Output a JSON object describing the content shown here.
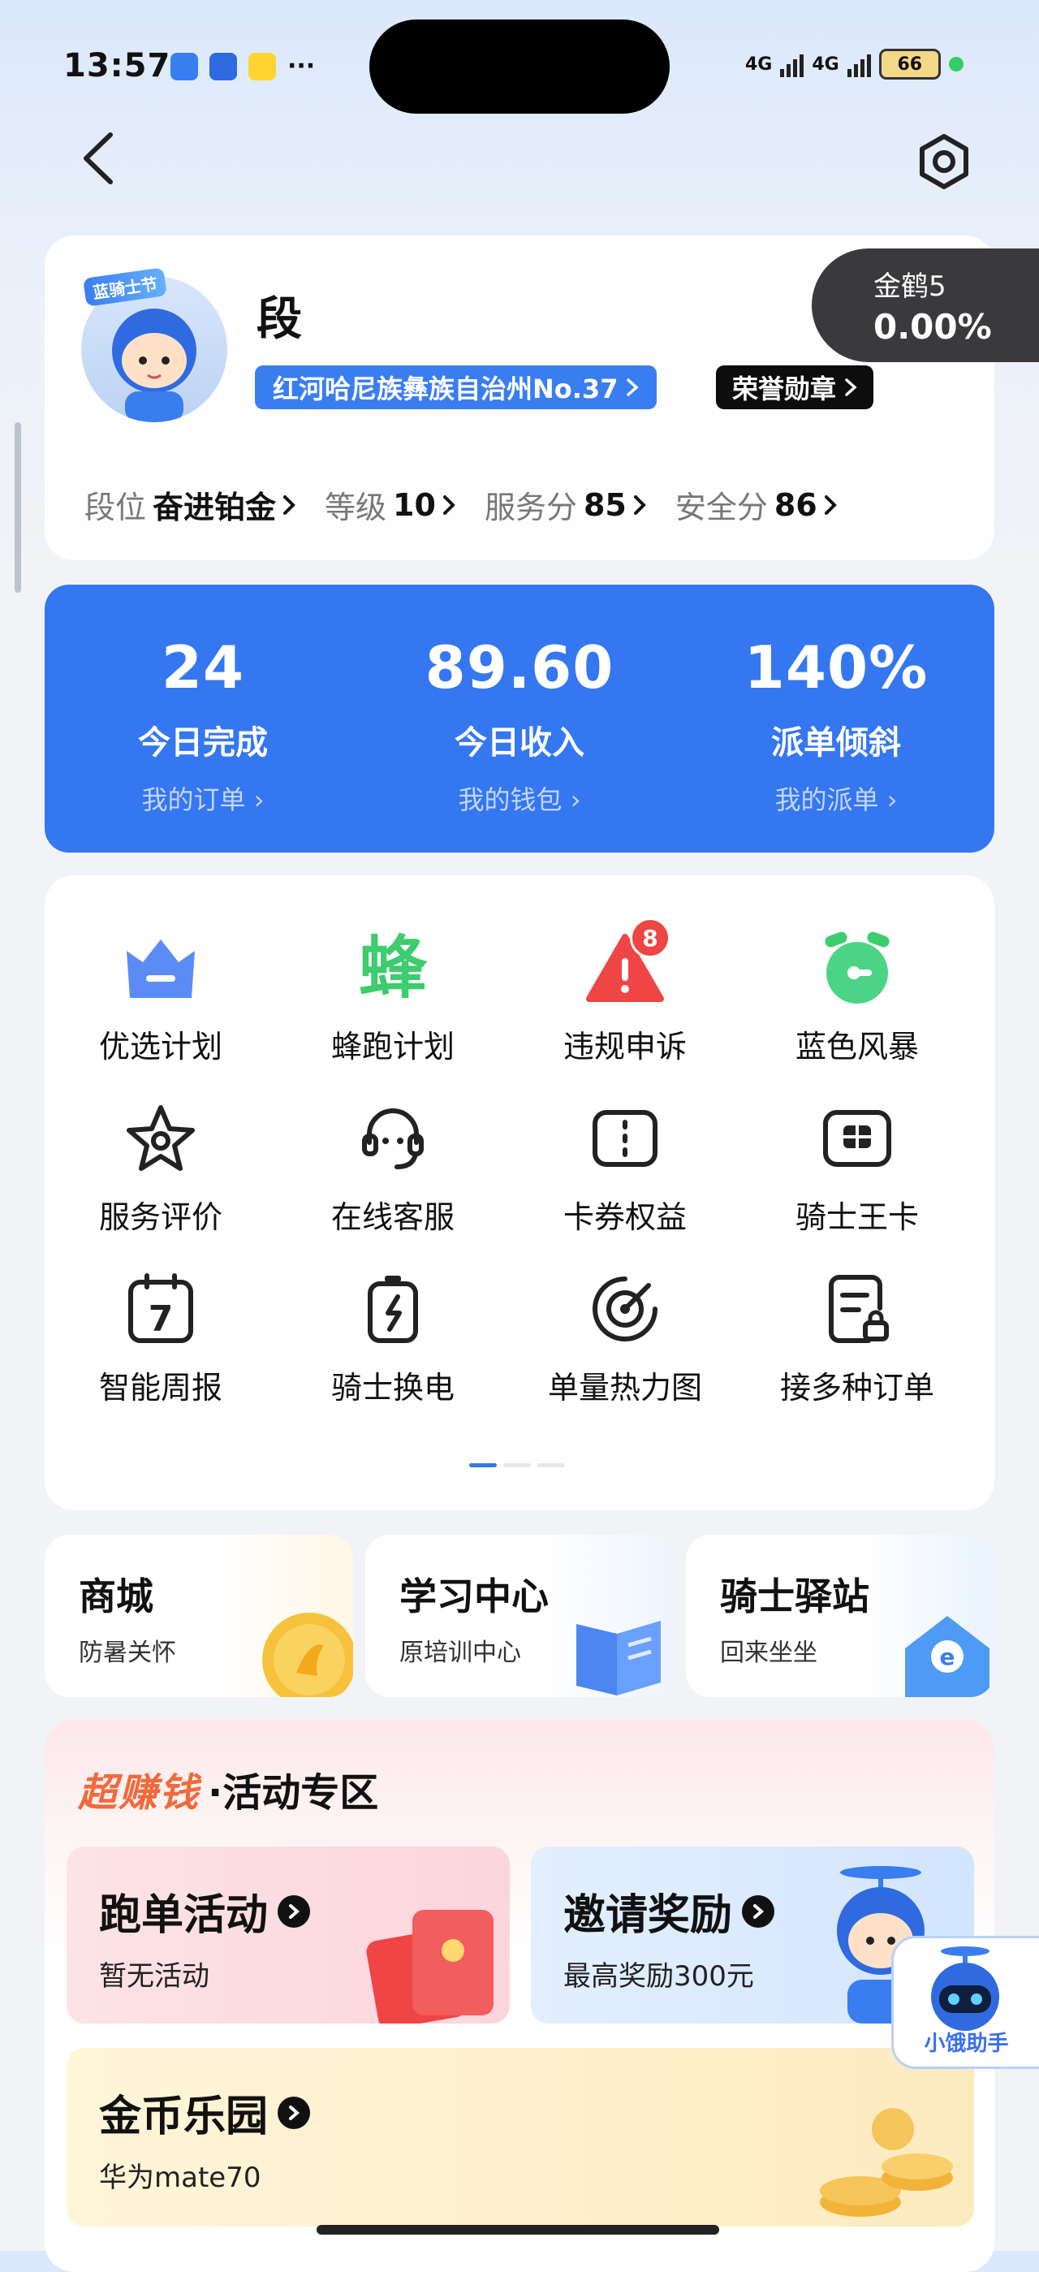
{
  "status_bar": {
    "time": "13:57",
    "network_1": "4G",
    "network_2": "4G",
    "battery": "66",
    "more": "···"
  },
  "profile": {
    "name": "段",
    "avatar_badge": "蓝骑士节",
    "region_tag": "红河哈尼族彝族自治州No.37",
    "honor_tag": "荣誉勋章",
    "level_title": "金鹤5",
    "level_value": "0.00%",
    "stats": [
      {
        "key": "段位",
        "value": "奋进铂金"
      },
      {
        "key": "等级",
        "value": "10"
      },
      {
        "key": "服务分",
        "value": "85"
      },
      {
        "key": "安全分",
        "value": "86"
      }
    ]
  },
  "summary": [
    {
      "number": "24",
      "label": "今日完成",
      "link": "我的订单"
    },
    {
      "number": "89.60",
      "label": "今日收入",
      "link": "我的钱包"
    },
    {
      "number": "140%",
      "label": "派单倾斜",
      "link": "我的派单"
    }
  ],
  "grid": [
    {
      "label": "优选计划",
      "icon": "crown-icon"
    },
    {
      "label": "蜂跑计划",
      "icon": "bee-run-icon"
    },
    {
      "label": "违规申诉",
      "icon": "warning-icon",
      "badge": "8"
    },
    {
      "label": "蓝色风暴",
      "icon": "alarm-clock-icon"
    },
    {
      "label": "服务评价",
      "icon": "star-icon"
    },
    {
      "label": "在线客服",
      "icon": "headset-icon"
    },
    {
      "label": "卡券权益",
      "icon": "coupon-icon"
    },
    {
      "label": "骑士王卡",
      "icon": "card-icon"
    },
    {
      "label": "智能周报",
      "icon": "calendar-icon",
      "icon_text": "7"
    },
    {
      "label": "骑士换电",
      "icon": "battery-swap-icon"
    },
    {
      "label": "单量热力图",
      "icon": "heatmap-icon"
    },
    {
      "label": "接多种订单",
      "icon": "order-doc-icon"
    }
  ],
  "grid_bee_char": "蜂",
  "mini_cards": [
    {
      "title": "商城",
      "sub": "防暑关怀"
    },
    {
      "title": "学习中心",
      "sub": "原培训中心"
    },
    {
      "title": "骑士驿站",
      "sub": "回来坐坐"
    }
  ],
  "activity": {
    "hot": "超赚钱",
    "title": "·活动专区",
    "run": {
      "title": "跑单活动",
      "sub": "暂无活动"
    },
    "invite": {
      "title": "邀请奖励",
      "sub": "最高奖励300元"
    },
    "coins": {
      "title": "金币乐园",
      "sub": "华为mate70"
    }
  },
  "assistant": {
    "label": "小饿助手"
  },
  "colors": {
    "primary": "#3577f0",
    "warning": "#f04545",
    "green": "#3dcc6e",
    "hot": "#f06a3c"
  }
}
